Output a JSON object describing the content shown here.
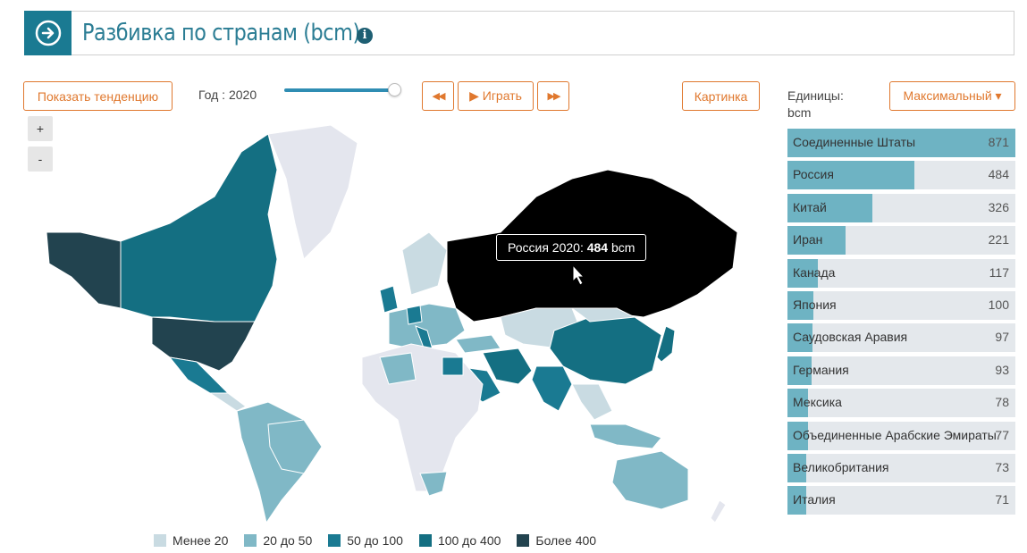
{
  "header": {
    "title": "Разбивка по странам (bcm)",
    "info_icon": "info-icon"
  },
  "controls": {
    "trend_button": "Показать тенденцию",
    "year_label": "Год : 2020",
    "year_slider_position": 1.0,
    "prev_button": "◀◀",
    "play_button": "▶ Играть",
    "next_button": "▶▶",
    "picture_button": "Картинка",
    "units_label": "Единицы:",
    "units_value": "bcm",
    "mode_select": "Максимальный ▾",
    "zoom_in": "+",
    "zoom_out": "-"
  },
  "tooltip": {
    "label": "Россия 2020: ",
    "value": "484",
    "unit": " bcm"
  },
  "ranking": [
    {
      "name": "Соединенные Штаты",
      "value": 871
    },
    {
      "name": "Россия",
      "value": 484
    },
    {
      "name": "Китай",
      "value": 326
    },
    {
      "name": "Иран",
      "value": 221
    },
    {
      "name": "Канада",
      "value": 117
    },
    {
      "name": "Япония",
      "value": 100
    },
    {
      "name": "Саудовская Аравия",
      "value": 97
    },
    {
      "name": "Германия",
      "value": 93
    },
    {
      "name": "Мексика",
      "value": 78
    },
    {
      "name": "Объединенные Арабские Эмираты",
      "value": 77
    },
    {
      "name": "Великобритания",
      "value": 73
    },
    {
      "name": "Италия",
      "value": 71
    }
  ],
  "legend": [
    {
      "label": "Менее 20",
      "color": "#c9dbe2"
    },
    {
      "label": "20 до 50",
      "color": "#80b8c6"
    },
    {
      "label": "50 до 100",
      "color": "#1a7a92"
    },
    {
      "label": "100 до 400",
      "color": "#146f82"
    },
    {
      "label": "Более 400",
      "color": "#22434f"
    }
  ],
  "colors": {
    "accent": "#1a7a92",
    "button_orange": "#e0782e",
    "bar_fill": "#6eb3c3",
    "bar_bg": "#e4e8ec",
    "no_data": "#e4e6ee",
    "highlight": "#000000"
  }
}
